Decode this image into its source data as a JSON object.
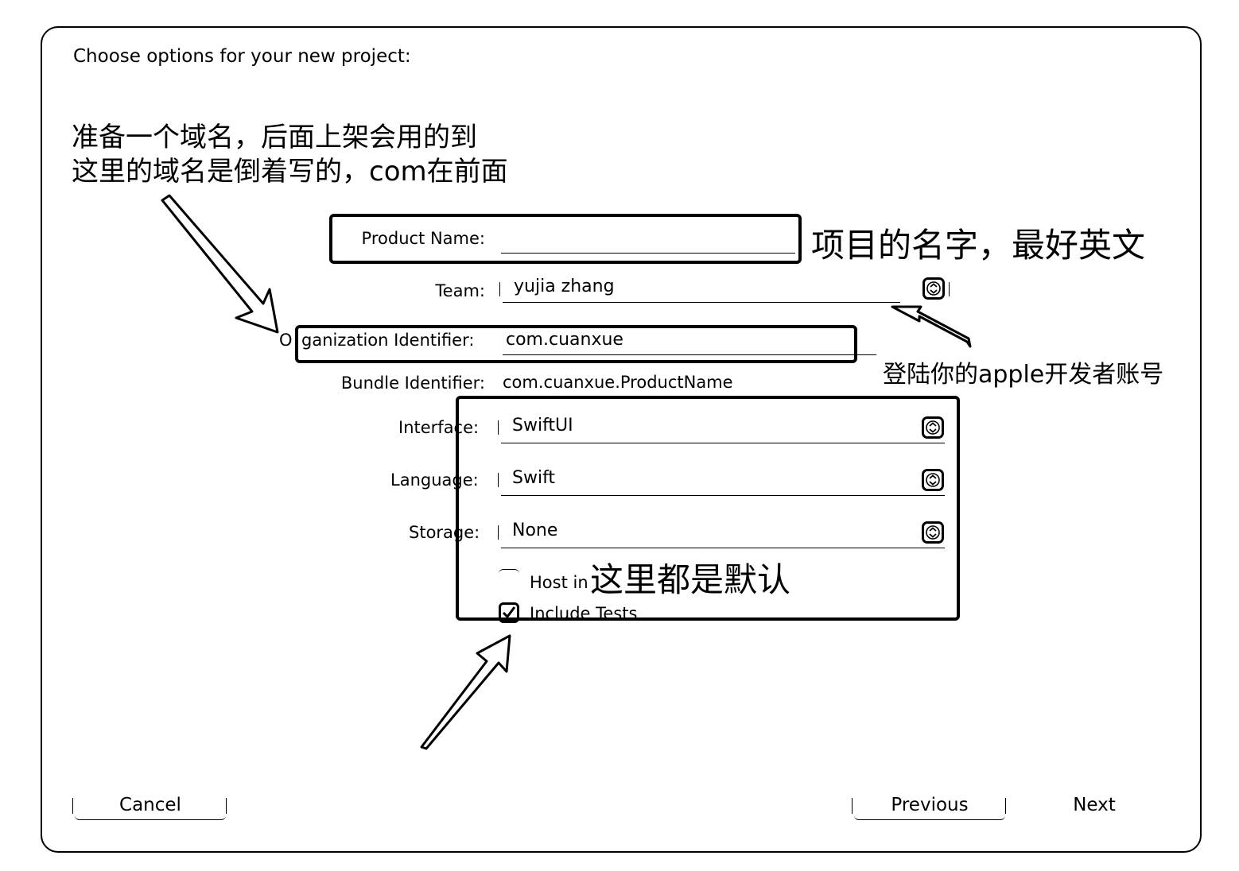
{
  "dialog": {
    "title": "Choose options for your new project:"
  },
  "form": {
    "product_name": {
      "label": "Product Name:",
      "value": ""
    },
    "team": {
      "label": "Team:",
      "value": "yujia zhang"
    },
    "org_id": {
      "label_prefix": "O",
      "label_rest": "ganization Identifier:",
      "value": "com.cuanxue"
    },
    "bundle_id": {
      "label": "Bundle Identifier:",
      "value": "com.cuanxue.ProductName"
    },
    "interface": {
      "label_a": "Interf",
      "label_b": "ace:",
      "value": "SwiftUI"
    },
    "language": {
      "label_a": "Langu",
      "label_b": "age:",
      "value": "Swift"
    },
    "storage": {
      "label_a": "Stor",
      "label_b": "age:",
      "value": "None"
    },
    "host_in_cloudkit": {
      "label": "Host in"
    },
    "include_tests": {
      "label": "Include Tests",
      "checked": true
    }
  },
  "buttons": {
    "cancel": "Cancel",
    "previous": "Previous",
    "next": "Next"
  },
  "annotations": {
    "domain_note_line1": "准备一个域名，后面上架会用的到",
    "domain_note_line2": "这里的域名是倒着写的，com在前面",
    "project_name_note": "项目的名字，最好英文",
    "apple_account_note": "登陆你的apple开发者账号",
    "defaults_note": "这里都是默认"
  },
  "icons": {
    "popup_stepper": "up-down-chevron-icon",
    "checkbox": "checkmark-icon"
  }
}
